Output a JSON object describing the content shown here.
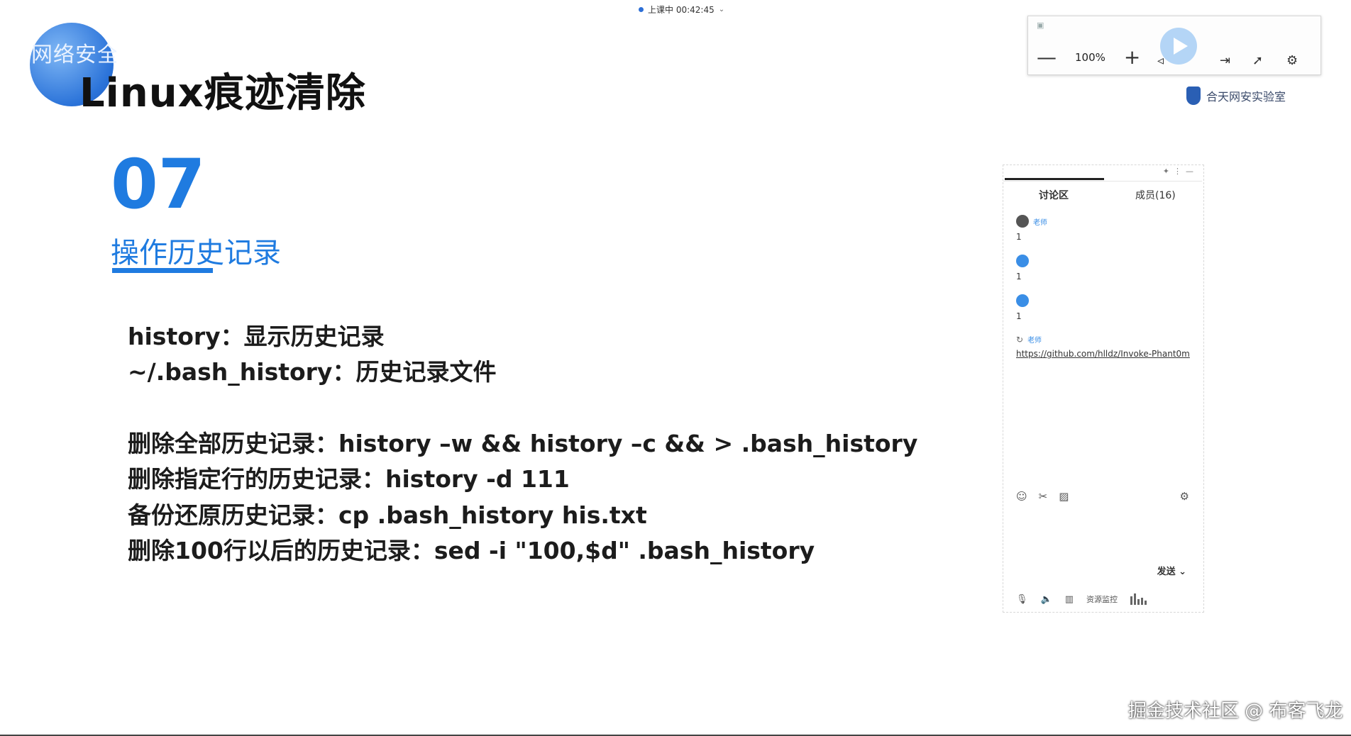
{
  "status_bar": {
    "text": "上课中 00:42:45"
  },
  "slide": {
    "logo_text": "网络安全",
    "title": "Linux痕迹清除",
    "section_number": "07",
    "section_title": "操作历史记录",
    "lines": [
      "history：显示历史记录",
      "~/.bash_history：历史记录文件",
      "删除全部历史记录：history –w && history –c && > .bash_history",
      "删除指定行的历史记录：history -d 111",
      "备份还原历史记录：cp .bash_history his.txt",
      "删除100行以后的历史记录：sed -i \"100,$d\" .bash_history"
    ]
  },
  "video_toolbar": {
    "zoom_out": "—",
    "zoom_level": "100%",
    "zoom_in": "+"
  },
  "brand": {
    "name": "合天网安实验室"
  },
  "chat": {
    "tabs": [
      {
        "label": "讨论区",
        "active": true
      },
      {
        "label": "成员(16)",
        "active": false
      }
    ],
    "messages": [
      {
        "role": "老师",
        "text": "1"
      },
      {
        "role": "",
        "text": "1"
      },
      {
        "role": "",
        "text": "1"
      },
      {
        "role": "老师",
        "text": "https://github.com/hlldz/Invoke-Phant0m"
      }
    ],
    "send_label": "发送",
    "resource_label": "资源监控"
  },
  "watermark": "掘金技术社区 @ 布客飞龙",
  "colors": {
    "accent": "#1f7be0",
    "link": "#2d6fd6"
  },
  "icons": [
    "minus-icon",
    "plus-icon",
    "play-icon",
    "volume-icon",
    "settings-icon",
    "emoji-icon",
    "scissors-icon",
    "image-icon",
    "mic-icon",
    "speaker-icon",
    "shield-icon"
  ]
}
